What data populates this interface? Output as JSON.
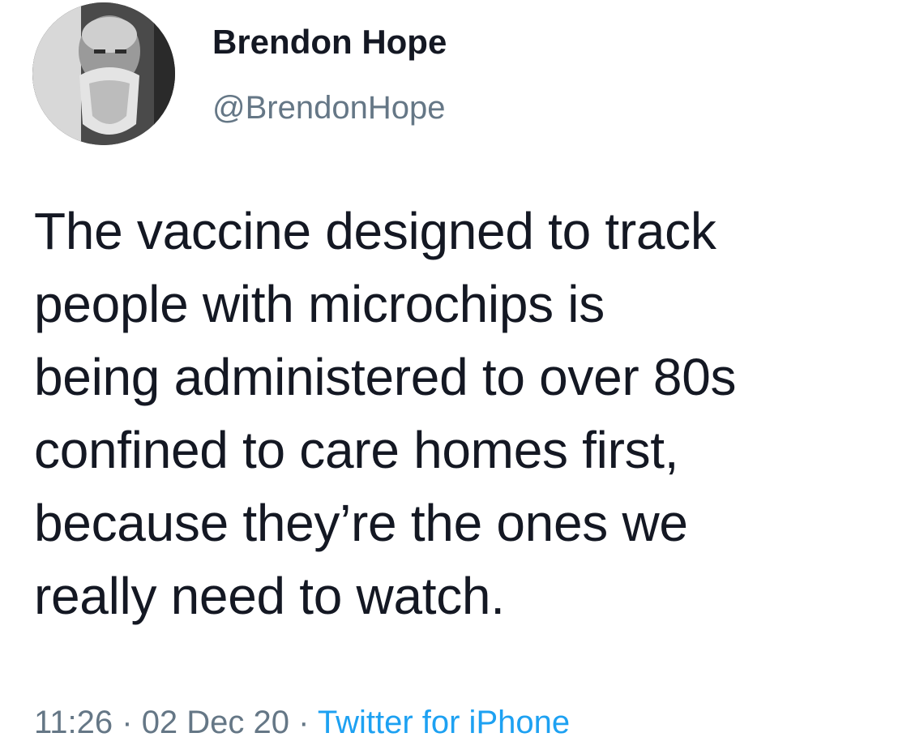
{
  "author": {
    "display_name": "Brendon Hope",
    "handle": "@BrendonHope"
  },
  "tweet": {
    "lines": [
      "The vaccine designed to track",
      "people with microchips is",
      "being administered to over 80s",
      "confined to care homes first,",
      "because they’re the ones we",
      "really need to watch."
    ]
  },
  "meta": {
    "time": "11:26",
    "separator": " · ",
    "date": "02 Dec 20",
    "source": "Twitter for iPhone"
  },
  "colors": {
    "text": "#141823",
    "muted": "#657786",
    "link": "#1da1f2"
  }
}
